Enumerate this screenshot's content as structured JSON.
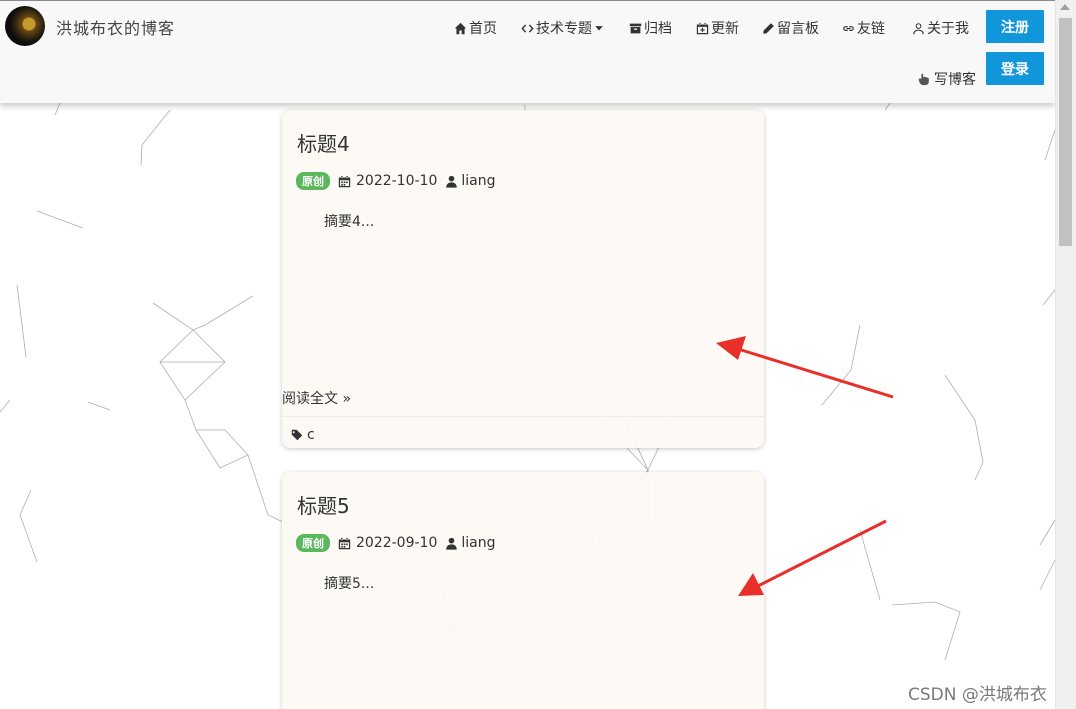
{
  "brand": {
    "title": "洪城布衣的博客"
  },
  "nav": {
    "home": "首页",
    "topics": "技术专题",
    "archive": "归档",
    "updates": "更新",
    "guestbook": "留言板",
    "links": "友链",
    "about": "关于我",
    "register": "注册",
    "login": "登录",
    "write_blog": "写博客"
  },
  "posts": [
    {
      "title": "标题4",
      "badge": "原创",
      "date": "2022-10-10",
      "author": "liang",
      "summary": "摘要4...",
      "read_more": "阅读全文 »",
      "tag": "c"
    },
    {
      "title": "标题5",
      "badge": "原创",
      "date": "2022-09-10",
      "author": "liang",
      "summary": "摘要5..."
    }
  ],
  "watermark": "CSDN @洪城布衣",
  "colors": {
    "primary_button": "#1296db",
    "badge_green": "#5cb85c",
    "arrow_red": "#e8302a"
  }
}
